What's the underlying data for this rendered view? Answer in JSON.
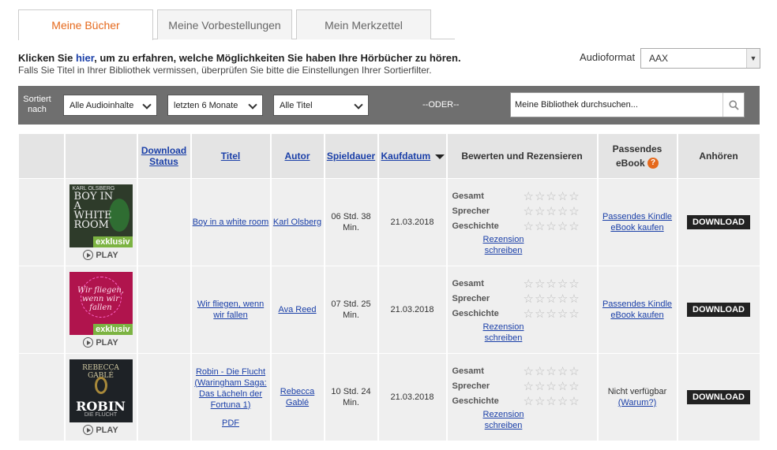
{
  "tabs": [
    {
      "label": "Meine Bücher"
    },
    {
      "label": "Meine Vorbestellungen"
    },
    {
      "label": "Mein Merkzettel"
    }
  ],
  "info": {
    "line1_before": "Klicken Sie ",
    "line1_link": "hier",
    "line1_after": ", um zu erfahren, welche Möglichkeiten Sie haben Ihre Hörbücher zu hören.",
    "line2": "Falls Sie Titel in Ihrer Bibliothek vermissen, überprüfen Sie bitte die Einstellungen Ihrer Sortierfilter."
  },
  "audioformat": {
    "label": "Audioformat",
    "value": "AAX"
  },
  "filters": {
    "sort_label_1": "Sortiert",
    "sort_label_2": "nach",
    "content": "Alle Audioinhalte",
    "period": "letzten 6 Monate",
    "titles": "Alle Titel",
    "oder": "--ODER--",
    "search_placeholder": "Meine Bibliothek durchsuchen..."
  },
  "table": {
    "headers": {
      "download_1": "Download",
      "download_2": "Status",
      "title": "Titel",
      "author": "Autor",
      "duration": "Spieldauer",
      "purchase": "Kaufdatum",
      "rate": "Bewerten und Rezensieren",
      "ebook_1": "Passendes",
      "ebook_2": "eBook",
      "listen": "Anhören"
    },
    "rating_labels": {
      "overall": "Gesamt",
      "narrator": "Sprecher",
      "story": "Geschichte"
    },
    "review_1": "Rezension",
    "review_2": "schreiben",
    "play": "PLAY",
    "download": "DOWNLOAD",
    "rows": [
      {
        "cover": {
          "author": "KARL OLSBERG",
          "title": "BOY IN A WHITE ROOM",
          "badge": "exklusiv"
        },
        "title": "Boy in a white room",
        "author": "Karl Olsberg",
        "duration_1": "06 Std. 38",
        "duration_2": "Min.",
        "date": "21.03.2018",
        "ebook_1": "Passendes Kindle",
        "ebook_2": "eBook kaufen"
      },
      {
        "cover": {
          "title": "Wir fliegen, wenn wir fallen",
          "badge": "exklusiv"
        },
        "title": "Wir fliegen, wenn wir fallen",
        "author": "Ava Reed",
        "duration_1": "07 Std. 25",
        "duration_2": "Min.",
        "date": "21.03.2018",
        "ebook_1": "Passendes Kindle",
        "ebook_2": "eBook kaufen"
      },
      {
        "cover": {
          "author": "REBECCA GABLÉ",
          "title": "ROBIN",
          "subtitle": "DIE FLUCHT"
        },
        "title": "Robin - Die Flucht (Waringham Saga: Das Lächeln der Fortuna 1)",
        "pdf": "PDF",
        "author": "Rebecca Gablé",
        "duration_1": "10 Std. 24",
        "duration_2": "Min.",
        "date": "21.03.2018",
        "ebook_1": "Nicht verfügbar",
        "ebook_2": "(Warum?)"
      }
    ]
  },
  "colors": {
    "accent": "#e5691c",
    "link": "#1a3fa8",
    "filterbar": "#6f6f6f"
  }
}
